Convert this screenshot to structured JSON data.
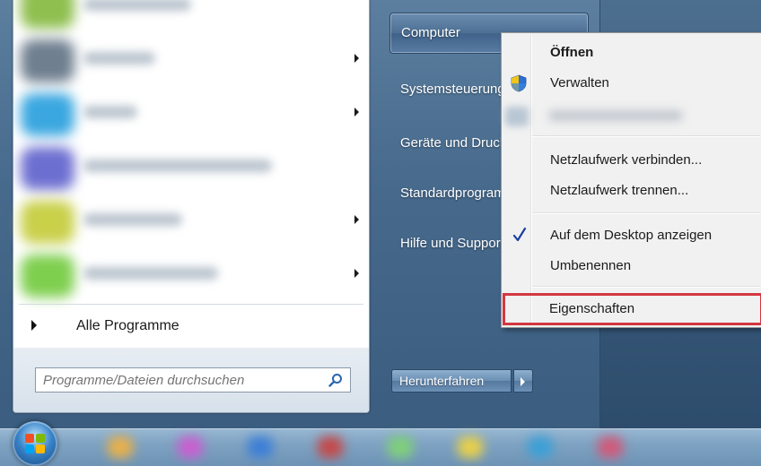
{
  "start_menu": {
    "programs": [
      {
        "blur_color": "#8fbf4f",
        "blur_width": 120,
        "has_submenu": false
      },
      {
        "blur_color": "#6f7f8f",
        "blur_width": 80,
        "has_submenu": true
      },
      {
        "blur_color": "#3aa7e0",
        "blur_width": 60,
        "has_submenu": true
      },
      {
        "blur_color": "#6d6fd0",
        "blur_width": 210,
        "has_submenu": false
      },
      {
        "blur_color": "#c9d04a",
        "blur_width": 110,
        "has_submenu": true
      },
      {
        "blur_color": "#7fcf4f",
        "blur_width": 150,
        "has_submenu": true
      }
    ],
    "all_programs_label": "Alle Programme",
    "search": {
      "placeholder": "Programme/Dateien durchsuchen",
      "icon": "search-icon"
    },
    "right_pane": {
      "items": [
        {
          "label": "Computer",
          "selected": true
        },
        {
          "label": "Systemsteuerung"
        },
        {
          "label": "Geräte und Drucker"
        },
        {
          "label": "Standardprogramme"
        },
        {
          "label": "Hilfe und Support"
        }
      ]
    },
    "shutdown": {
      "label": "Herunterfahren",
      "arrow_icon": "chevron-right-icon"
    }
  },
  "context_menu": {
    "items": [
      {
        "label": "Öffnen",
        "bold": true
      },
      {
        "label": "Verwalten",
        "icon": "uac-shield-icon"
      },
      {
        "label": "",
        "blurred": true
      },
      {
        "label": "Netzlaufwerk verbinden..."
      },
      {
        "label": "Netzlaufwerk trennen..."
      },
      {
        "label": "Auf dem Desktop anzeigen",
        "checked": true,
        "icon": "check-icon"
      },
      {
        "label": "Umbenennen"
      },
      {
        "label": "Eigenschaften",
        "highlighted": true
      }
    ],
    "highlight_color": "#d3383f"
  },
  "taskbar": {
    "start_orb_icon": "windows-logo-icon",
    "blurred_buttons": [
      "#e8b04a",
      "#c95fd0",
      "#3d7fd6",
      "#c44a4a",
      "#7fd07a",
      "#e8d04a",
      "#3da0d6",
      "#d05a7a"
    ]
  }
}
